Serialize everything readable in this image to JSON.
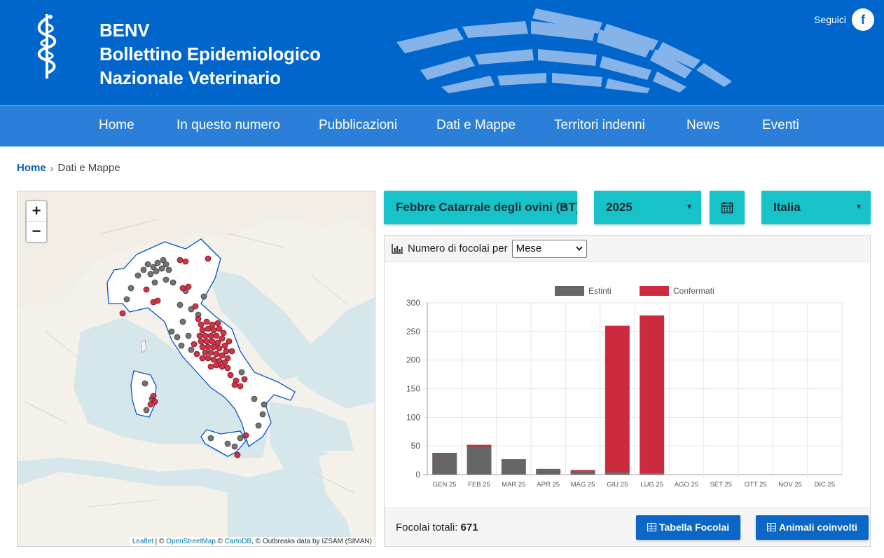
{
  "header": {
    "brand_line1": "BENV",
    "brand_line2": "Bollettino Epidemiologico",
    "brand_line3": "Nazionale Veterinario",
    "social_label": "Seguici",
    "social_icon": "facebook-icon",
    "brand_color": "#0066cc"
  },
  "nav": {
    "items": [
      "Home",
      "In questo numero",
      "Pubblicazioni",
      "Dati e Mappe",
      "Territori indenni",
      "News",
      "Eventi"
    ]
  },
  "breadcrumb": {
    "home": "Home",
    "current": "Dati e Mappe"
  },
  "map": {
    "zoom_in": "+",
    "zoom_out": "−",
    "attribution": {
      "leaflet": "Leaflet",
      "osm": "OpenStreetMap",
      "cartodb": "CartoDB",
      "outbreaks": ", © Outbreaks data by IZSAM (SIMAN)"
    },
    "legend_colors": {
      "estinti": "#6b6b6b",
      "confermati": "#cc2a3e"
    }
  },
  "filters": {
    "disease": "Febbre Catarrale degli ovini (BT)",
    "year": "2025",
    "calendar_icon": "calendar-icon",
    "area": "Italia"
  },
  "panel": {
    "title": "Numero di focolai per",
    "group_by": "Mese",
    "total_label": "Focolai totali:",
    "total_value": "671",
    "btn_table": "Tabella Focolai",
    "btn_animals": "Animali coinvolti"
  },
  "chart_data": {
    "type": "bar",
    "stacked": true,
    "categories": [
      "GEN 25",
      "FEB 25",
      "MAR 25",
      "APR 25",
      "MAG 25",
      "GIU 25",
      "LUG 25",
      "AGO 25",
      "SET 25",
      "OTT 25",
      "NOV 25",
      "DIC 25"
    ],
    "series": [
      {
        "name": "Estinti",
        "color": "#666666",
        "values": [
          36,
          49,
          26,
          10,
          5,
          4,
          2,
          0,
          0,
          0,
          0,
          0
        ]
      },
      {
        "name": "Confermati",
        "color": "#cc2a3e",
        "values": [
          2,
          3,
          1,
          0,
          3,
          256,
          276,
          0,
          0,
          0,
          0,
          0
        ]
      }
    ],
    "ylim": [
      0,
      300
    ],
    "yticks": [
      0,
      50,
      100,
      150,
      200,
      250,
      300
    ],
    "grid": true,
    "legend_position": "top"
  }
}
